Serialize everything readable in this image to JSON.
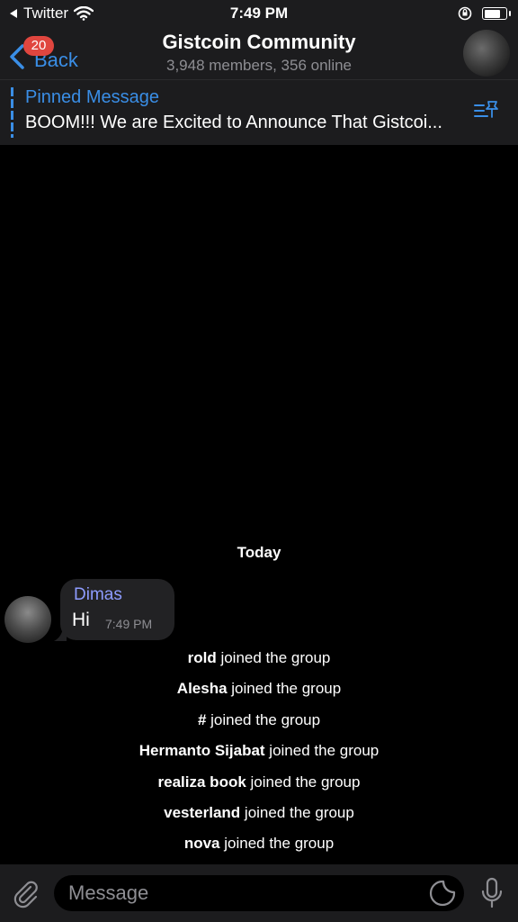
{
  "status_bar": {
    "back_app": "Twitter",
    "time": "7:49 PM",
    "battery_level": 0.85
  },
  "header": {
    "back_label": "Back",
    "unread_count": "20",
    "title": "Gistcoin Community",
    "subtitle": "3,948 members, 356 online"
  },
  "pinned": {
    "title": "Pinned Message",
    "text": "BOOM!!!  We are Excited to Announce That Gistcoi..."
  },
  "chat": {
    "date_label": "Today",
    "message": {
      "sender": "Dimas",
      "text": "Hi",
      "time": "7:49 PM"
    },
    "service_messages": [
      {
        "name": "rold",
        "action": " joined the group"
      },
      {
        "name": "Alesha",
        "action": " joined the group"
      },
      {
        "name": "#",
        "action": " joined the group"
      },
      {
        "name": "Hermanto Sijabat",
        "action": " joined the group"
      },
      {
        "name": "realiza book",
        "action": " joined the group"
      },
      {
        "name": "vesterland",
        "action": " joined the group"
      },
      {
        "name": "nova",
        "action": " joined the group"
      }
    ]
  },
  "composer": {
    "placeholder": "Message"
  },
  "colors": {
    "accent": "#3a8ee6",
    "sender_name": "#8e9cff",
    "badge": "#e0463f",
    "bar_background": "#1c1c1e",
    "bubble": "#222224"
  },
  "icons": [
    "wifi-icon",
    "orientation-lock-icon",
    "battery-icon",
    "chevron-left-icon",
    "pinned-list-icon",
    "paperclip-icon",
    "sticker-icon",
    "microphone-icon"
  ]
}
